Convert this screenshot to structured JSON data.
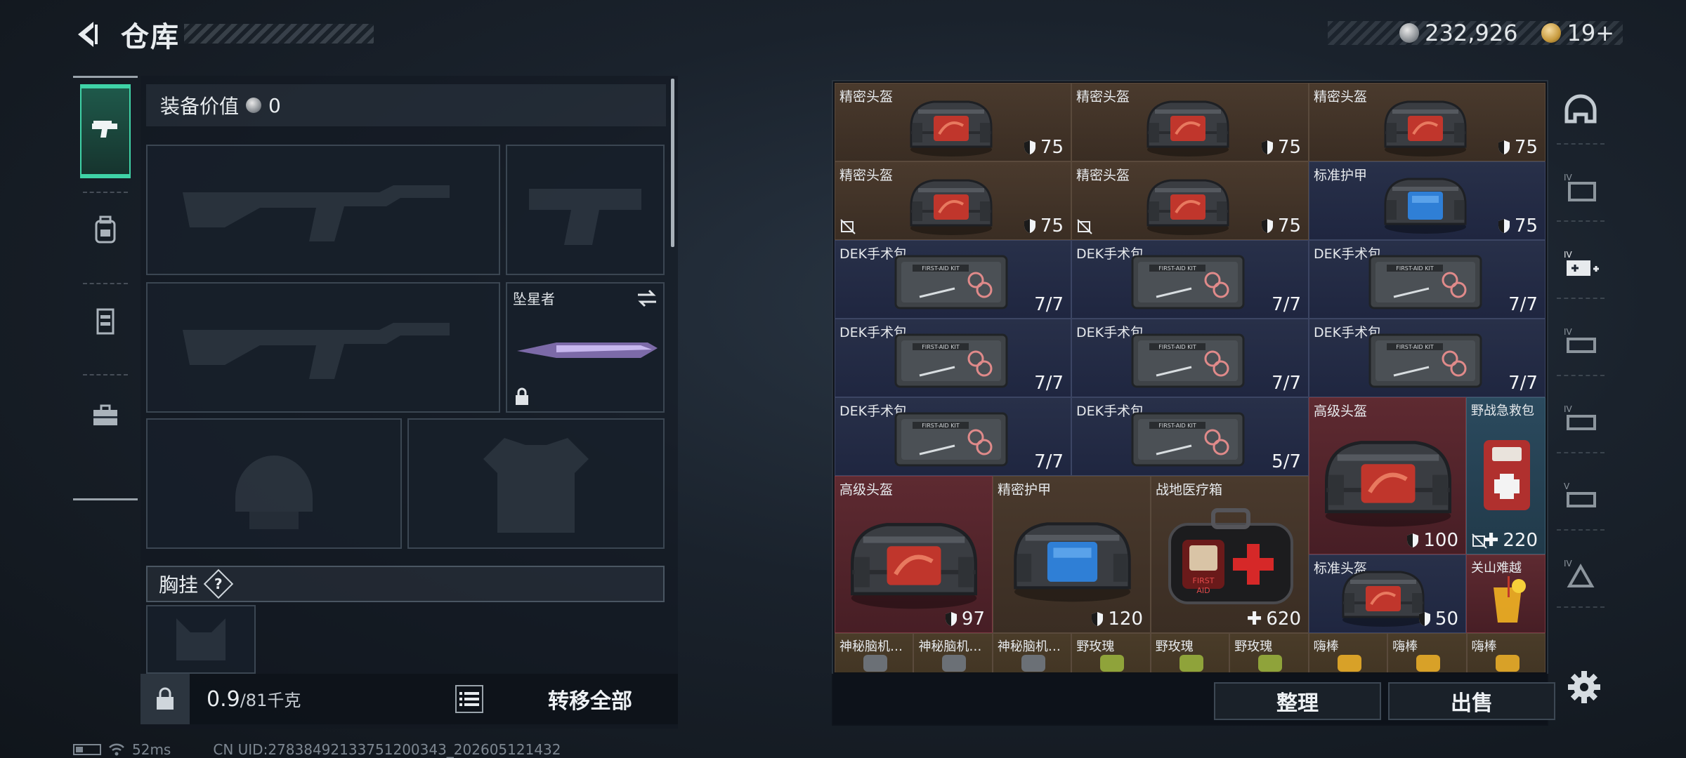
{
  "header": {
    "title": "仓库",
    "currency_amount": "232,926",
    "token_amount": "19+"
  },
  "equipment": {
    "value_label": "装备价值",
    "value_amount": "0",
    "melee_name": "坠星者",
    "chest_rig_label": "胸挂",
    "help_mark": "?"
  },
  "footer_left": {
    "weight_current": "0.9",
    "weight_max": "/81千克",
    "transfer_all": "转移全部"
  },
  "footer_right": {
    "sort": "整理",
    "sell": "出售"
  },
  "status": {
    "ping": "52ms",
    "uid": "CN UID:2783849213375120034­3_202605121432"
  },
  "inventory": {
    "row1": [
      {
        "name": "精密头盔",
        "value": "75"
      },
      {
        "name": "精密头盔",
        "value": "75"
      },
      {
        "name": "精密头盔",
        "value": "75"
      }
    ],
    "row2": [
      {
        "name": "精密头盔",
        "value": "75"
      },
      {
        "name": "精密头盔",
        "value": "75"
      },
      {
        "name": "标准护甲",
        "value": "75"
      }
    ],
    "row3": [
      {
        "name": "DEK手术包",
        "value": "7/7"
      },
      {
        "name": "DEK手术包",
        "value": "7/7"
      },
      {
        "name": "DEK手术包",
        "value": "7/7"
      }
    ],
    "row4": [
      {
        "name": "DEK手术包",
        "value": "7/7"
      },
      {
        "name": "DEK手术包",
        "value": "7/7"
      },
      {
        "name": "DEK手术包",
        "value": "7/7"
      }
    ],
    "row5": [
      {
        "name": "DEK手术包",
        "value": "7/7"
      },
      {
        "name": "DEK手术包",
        "value": "5/7"
      }
    ],
    "adv_helmet_right": {
      "name": "高级头盔",
      "value": "100"
    },
    "field_kit": {
      "name": "野战急救包",
      "value": "220"
    },
    "adv_helmet_left": {
      "name": "高级头盔",
      "value": "97"
    },
    "precise_armor": {
      "name": "精密护甲",
      "value": "120"
    },
    "medical_box": {
      "name": "战地医疗箱",
      "value": "620"
    },
    "std_helmet": {
      "name": "标准头盔",
      "value": "50"
    },
    "drink": {
      "name": "关山难越"
    },
    "small_row": [
      "神秘脑机…",
      "神秘脑机…",
      "神秘脑机…",
      "野玫瑰",
      "野玫瑰",
      "野玫瑰",
      "嗨棒",
      "嗨棒",
      "嗨棒"
    ]
  },
  "colors": {
    "accent_green": "#3fd3a7",
    "cell_brown": "#4a3a2d",
    "cell_navy": "#283049",
    "cell_red": "#5e2a31",
    "cell_teal": "#2b4a5e"
  }
}
